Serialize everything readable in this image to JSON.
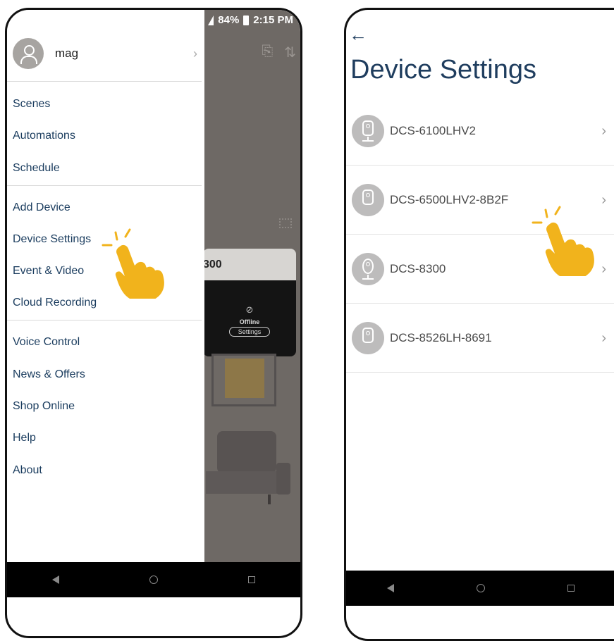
{
  "left_screen": {
    "status": {
      "battery": "84%",
      "time": "2:15 PM"
    },
    "profile": {
      "name": "mag"
    },
    "menu_groups": [
      [
        "Scenes",
        "Automations",
        "Schedule"
      ],
      [
        "Add Device",
        "Device Settings",
        "Event & Video",
        "Cloud Recording"
      ],
      [
        "Voice Control",
        "News & Offers",
        "Shop Online",
        "Help",
        "About"
      ]
    ],
    "background_card": {
      "title_fragment": "300",
      "status_text": "Offline",
      "button_label": "Settings"
    }
  },
  "right_screen": {
    "title": "Device Settings",
    "devices": [
      "DCS-6100LHV2",
      "DCS-6500LHV2-8B2F",
      "DCS-8300",
      "DCS-8526LH-8691"
    ]
  },
  "colors": {
    "accent": "#1f3d5e",
    "tap_hand": "#f1b31c",
    "overlay": "#6e6965"
  },
  "icons": [
    "back-arrow-icon",
    "chevron-right-icon",
    "user-icon",
    "camera-icon",
    "tap-hand-icon"
  ]
}
